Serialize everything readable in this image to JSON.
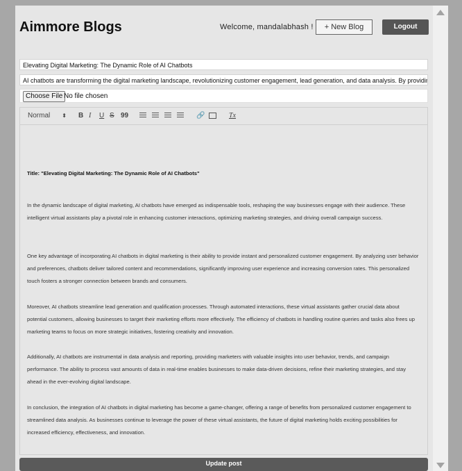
{
  "header": {
    "site_title": "Aimmore Blogs",
    "welcome_text": "Welcome, mandalabhash !",
    "new_blog_label": "+ New Blog",
    "logout_label": "Logout"
  },
  "form": {
    "title_value": "Elevating Digital Marketing: The Dynamic Role of AI Chatbots",
    "description_value": "AI chatbots are transforming the digital marketing landscape, revolutionizing customer engagement, lead generation, and data analysis. By providing pe",
    "choose_file_label": "Choose File",
    "file_status": "No file chosen"
  },
  "toolbar": {
    "size_select": "Normal",
    "bold": "B",
    "italic": "I",
    "underline": "U",
    "strike": "S",
    "quote": "99",
    "clean": "Tx"
  },
  "editor": {
    "heading": "Title: \"Elevating Digital Marketing: The Dynamic Role of AI Chatbots\"",
    "paragraphs": [
      "In the dynamic landscape of digital marketing, AI chatbots have emerged as indispensable tools, reshaping the way businesses engage with their audience. These intelligent virtual assistants play a pivotal role in enhancing customer interactions, optimizing marketing strategies, and driving overall campaign success.",
      "One key advantage of incorporating AI chatbots in digital marketing is their ability to provide instant and personalized customer engagement. By analyzing user behavior and preferences, chatbots deliver tailored content and recommendations, significantly improving user experience and increasing conversion rates. This personalized touch fosters a stronger connection between brands and consumers.",
      "Moreover, AI chatbots streamline lead generation and qualification processes. Through automated interactions, these virtual assistants gather crucial data about potential customers, allowing businesses to target their marketing efforts more effectively. The efficiency of chatbots in handling routine queries and tasks also frees up marketing teams to focus on more strategic initiatives, fostering creativity and innovation.",
      "Additionally, AI chatbots are instrumental in data analysis and reporting, providing marketers with valuable insights into user behavior, trends, and campaign performance. The ability to process vast amounts of data in real-time enables businesses to make data-driven decisions, refine their marketing strategies, and stay ahead in the ever-evolving digital landscape.",
      "In conclusion, the integration of AI chatbots in digital marketing has become a game-changer, offering a range of benefits from personalized customer engagement to streamlined data analysis. As businesses continue to leverage the power of these virtual assistants, the future of digital marketing holds exciting possibilities for increased efficiency, effectiveness, and innovation."
    ]
  },
  "actions": {
    "update_label": "Update post"
  }
}
